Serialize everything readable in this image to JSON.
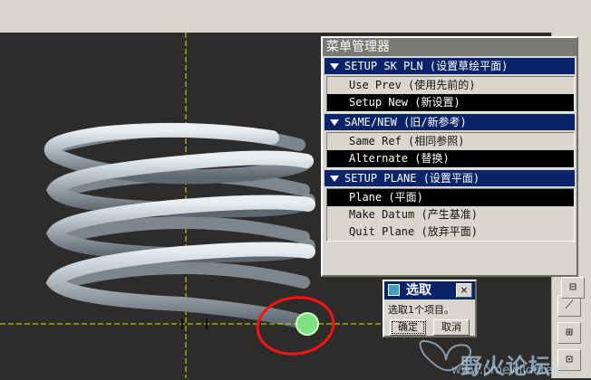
{
  "menu_manager": {
    "title": "菜单管理器",
    "sections": [
      {
        "header": "SETUP SK PLN (设置草绘平面)",
        "items": [
          {
            "label": "Use Prev (使用先前的)",
            "selected": false
          },
          {
            "label": "Setup New (新设置)",
            "selected": true
          }
        ]
      },
      {
        "header": "SAME/NEW (旧/新参考)",
        "items": [
          {
            "label": "Same Ref (相同参照)",
            "selected": false
          },
          {
            "label": "Alternate (替换)",
            "selected": true
          }
        ]
      },
      {
        "header": "SETUP PLANE (设置平面)",
        "items": [
          {
            "label": "Plane (平面)",
            "selected": true
          },
          {
            "label": "Make Datum (产生基准)",
            "selected": false
          },
          {
            "label": "Quit Plane (放弃平面)",
            "selected": false
          }
        ]
      }
    ]
  },
  "select_dialog": {
    "title": "选取",
    "close": "×",
    "message": "选取1个项目。",
    "ok_label": "确定",
    "cancel_label": "取消"
  },
  "watermark": {
    "title": "野火论坛",
    "url": "www.proewildfire.cn"
  },
  "colors": {
    "viewport_bg": "#2e2c2a",
    "spring": "#a9b3bc",
    "datum_axis": "#e0e000",
    "highlight_circle": "#ff1010",
    "selection_point": "#6fe06f",
    "menu_header_bg": "#0a246a"
  }
}
